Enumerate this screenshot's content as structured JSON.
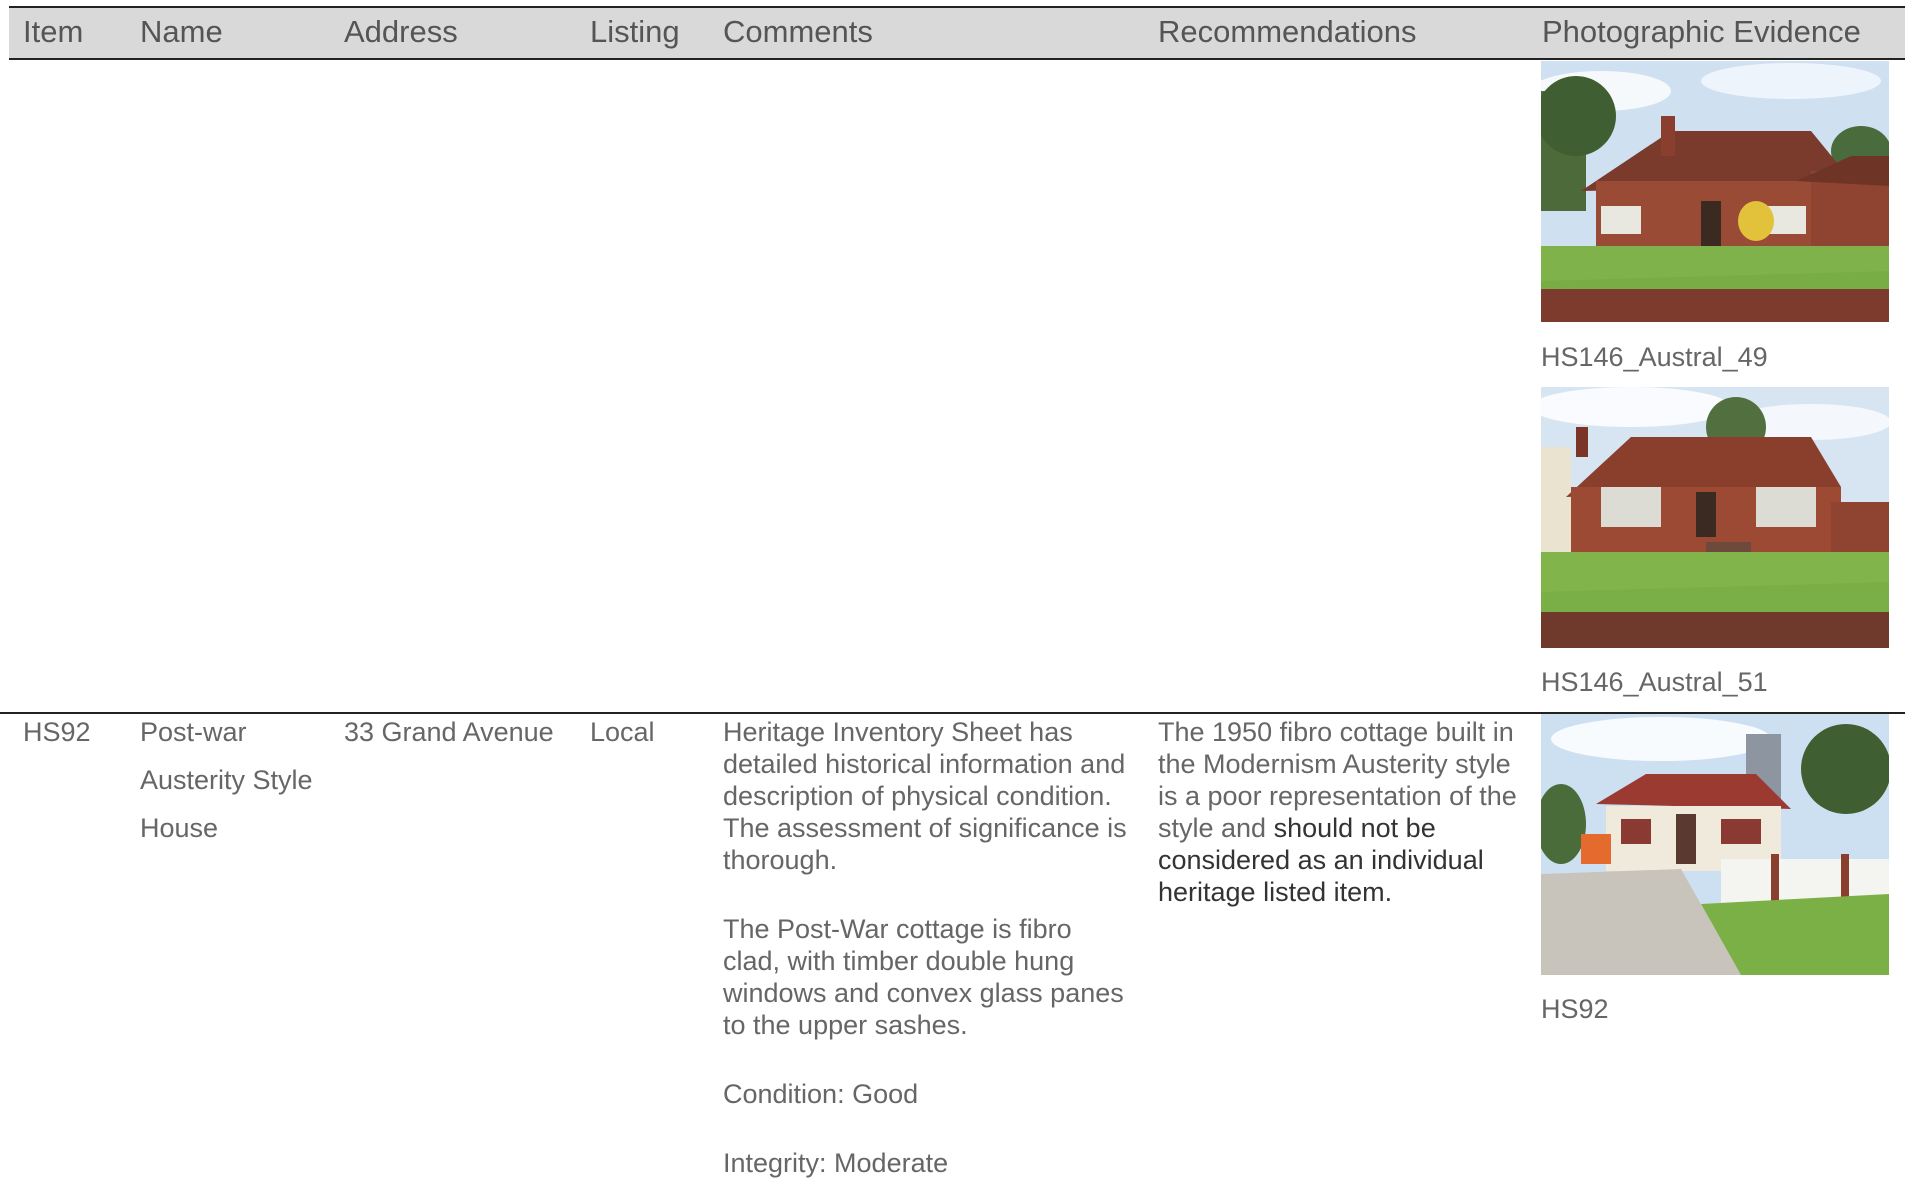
{
  "header": {
    "item": "Item",
    "name": "Name",
    "address": "Address",
    "listing": "Listing",
    "comments": "Comments",
    "recommendations": "Recommendations",
    "photo": "Photographic Evidence"
  },
  "prev_row": {
    "photos": [
      {
        "caption": "HS146_Austral_49"
      },
      {
        "caption": "HS146_Austral_51"
      }
    ]
  },
  "row": {
    "item": "HS92",
    "name_lines": [
      "Post-war",
      "Austerity Style",
      "House"
    ],
    "address": "33 Grand Avenue",
    "listing": "Local",
    "comments": {
      "p1": "Heritage Inventory Sheet has detailed historical information and description of physical condition. The assessment of significance is thorough.",
      "p2": "The Post-War cottage is fibro clad, with timber double hung windows and convex glass panes to the upper sashes.",
      "condition": "Condition: Good",
      "integrity": "Integrity: Moderate"
    },
    "recommendations": {
      "plain": "The 1950 fibro cottage built in the Modernism Austerity style is a poor representation of the style and ",
      "emphasis": "should not be considered as an individual heritage listed item."
    },
    "photo_caption": "HS92"
  }
}
